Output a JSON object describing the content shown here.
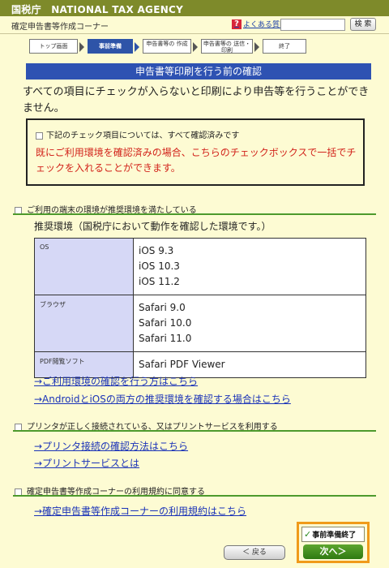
{
  "header": {
    "agency": "国税庁　NATIONAL TAX AGENCY",
    "corner_name": "確定申告書等作成コーナー",
    "help_link": "よくある質問",
    "help_icon": "question-mark-icon",
    "search_button": "検 索",
    "search_placeholder": ""
  },
  "steps": [
    {
      "label": "トップ画面"
    },
    {
      "label": "事前準備"
    },
    {
      "label": "申告書等の 作成"
    },
    {
      "label": "申告書等の 送信・印刷"
    },
    {
      "label": "終了"
    }
  ],
  "heading": "申告書等印刷を行う前の確認",
  "intro": "すべての項目にチェックが入らないと印刷により申告等を行うことができません。",
  "confirm_box": {
    "all_label": "下記のチェック項目については、すべて確認済みです",
    "note": "既にご利用環境を確認済みの場合、こちらのチェックボックスで一括でチェックを入れることができます。"
  },
  "section_env": {
    "title": "ご利用の端末の環境が推奨環境を満たしている",
    "caption": "推奨環境（国税庁において動作を確認した環境です。）",
    "table": [
      {
        "key": "OS",
        "values": [
          "iOS 9.3",
          "iOS 10.3",
          "iOS 11.2"
        ]
      },
      {
        "key": "ブラウザ",
        "values": [
          "Safari 9.0",
          "Safari 10.0",
          "Safari 11.0"
        ]
      },
      {
        "key": "PDF閲覧ソフト",
        "values": [
          "Safari PDF Viewer"
        ]
      }
    ],
    "links": [
      "→ご利用環境の確認を行う方はこちら",
      "→AndroidとiOSの両方の推奨環境を確認する場合はこちら"
    ]
  },
  "section_printer": {
    "title": "プリンタが正しく接続されている、又はプリントサービスを利用する",
    "links": [
      "→プリンタ接続の確認方法はこちら",
      "→プリントサービスとは"
    ]
  },
  "section_terms": {
    "title": "確定申告書等作成コーナーの利用規約に同意する",
    "links": [
      "→確定申告書等作成コーナーの利用規約はこちら"
    ]
  },
  "footer": {
    "back_button": "＜ 戻る",
    "prep_done": "事前準備終了",
    "next_button": "次へ＞"
  },
  "colors": {
    "background": "#fdfbd3",
    "topbar": "#7e8a2a",
    "heading": "#2e52b2",
    "red_note": "#d2231b",
    "link": "#1b33b8",
    "green_rule": "#4d9a2c",
    "highlight_frame": "#f09a1a"
  }
}
